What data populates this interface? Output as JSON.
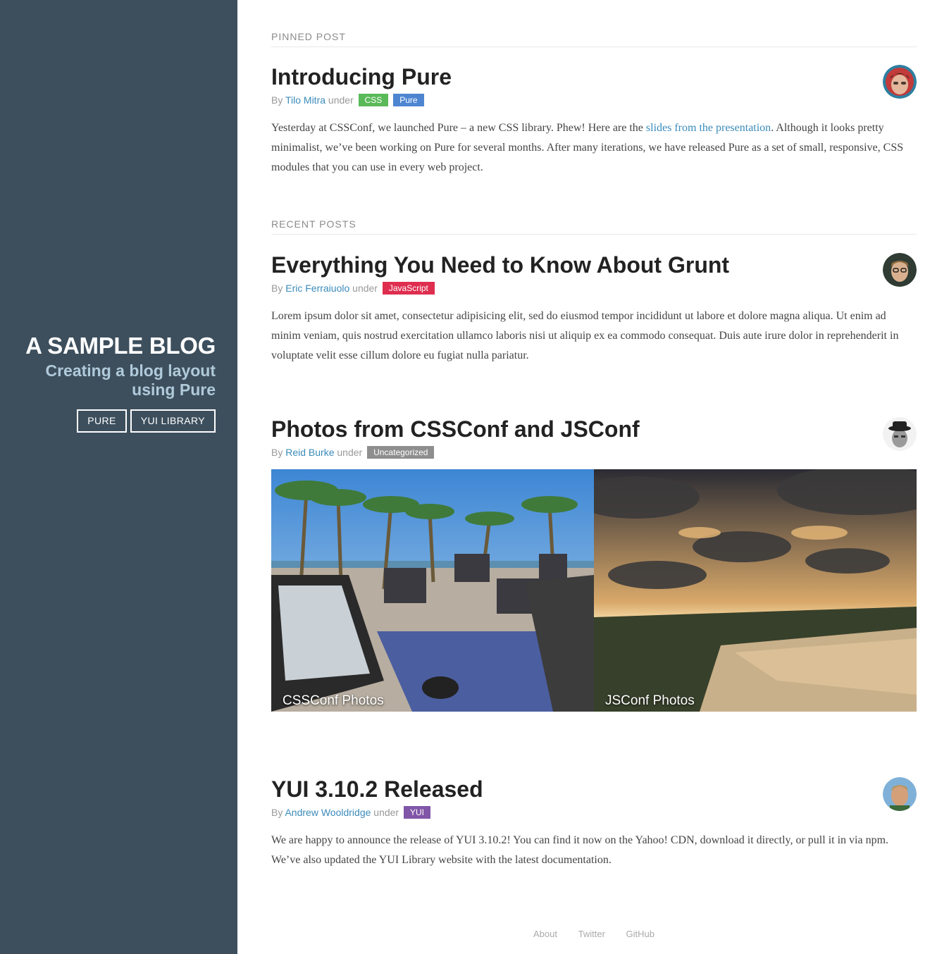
{
  "sidebar": {
    "title": "A SAMPLE BLOG",
    "tagline": "Creating a blog layout using Pure",
    "nav": [
      {
        "label": "PURE"
      },
      {
        "label": "YUI LIBRARY"
      }
    ]
  },
  "pinned": {
    "heading": "PINNED POST",
    "post": {
      "title": "Introducing Pure",
      "by": "By",
      "author": "Tilo Mitra",
      "under": "under",
      "categories": [
        {
          "label": "CSS",
          "color": "#5aba59"
        },
        {
          "label": "Pure",
          "color": "#4d85d1"
        }
      ],
      "body_before": "Yesterday at CSSConf, we launched Pure – a new CSS library. Phew! Here are the ",
      "body_link": "slides from the presentation",
      "body_after": ". Although it looks pretty minimalist, we’ve been working on Pure for several months. After many iterations, we have released Pure as a set of small, responsive, CSS modules that you can use in every web project."
    }
  },
  "recent": {
    "heading": "RECENT POSTS",
    "posts": [
      {
        "title": "Everything You Need to Know About Grunt",
        "by": "By",
        "author": "Eric Ferraiuolo",
        "under": "under",
        "categories": [
          {
            "label": "JavaScript",
            "color": "#df2d4f"
          }
        ],
        "body": "Lorem ipsum dolor sit amet, consectetur adipisicing elit, sed do eiusmod tempor incididunt ut labore et dolore magna aliqua. Ut enim ad minim veniam, quis nostrud exercitation ullamco laboris nisi ut aliquip ex ea commodo consequat. Duis aute irure dolor in reprehenderit in voluptate velit esse cillum dolore eu fugiat nulla pariatur."
      },
      {
        "title": "Photos from CSSConf and JSConf",
        "by": "By",
        "author": "Reid Burke",
        "under": "under",
        "categories": [
          {
            "label": "Uncategorized",
            "color": "#8e8e8e"
          }
        ],
        "photos": [
          {
            "caption": "CSSConf Photos"
          },
          {
            "caption": "JSConf Photos"
          }
        ]
      },
      {
        "title": "YUI 3.10.2 Released",
        "by": "By",
        "author": "Andrew Wooldridge",
        "under": "under",
        "categories": [
          {
            "label": "YUI",
            "color": "#8156a7"
          }
        ],
        "body": "We are happy to announce the release of YUI 3.10.2! You can find it now on the Yahoo! CDN, download it directly, or pull it in via npm. We’ve also updated the YUI Library website with the latest documentation."
      }
    ]
  },
  "footer": {
    "links": [
      {
        "label": "About"
      },
      {
        "label": "Twitter"
      },
      {
        "label": "GitHub"
      }
    ]
  }
}
